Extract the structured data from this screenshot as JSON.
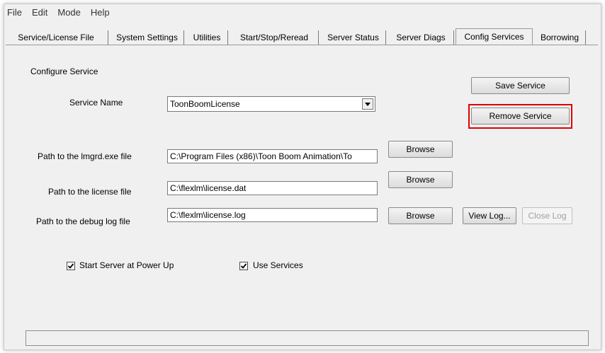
{
  "menu": [
    "File",
    "Edit",
    "Mode",
    "Help"
  ],
  "tabs": [
    {
      "label": "Service/License File",
      "active": false
    },
    {
      "label": "System Settings",
      "active": false
    },
    {
      "label": "Utilities",
      "active": false
    },
    {
      "label": "Start/Stop/Reread",
      "active": false
    },
    {
      "label": "Server Status",
      "active": false
    },
    {
      "label": "Server Diags",
      "active": false
    },
    {
      "label": "Config Services",
      "active": true
    },
    {
      "label": "Borrowing",
      "active": false
    }
  ],
  "config": {
    "section_title": "Configure Service",
    "service_name_label": "Service Name",
    "service_name_value": "ToonBoomLicense",
    "lmgrd_label": "Path to the lmgrd.exe file",
    "lmgrd_value": "C:\\Program Files (x86)\\Toon Boom Animation\\To",
    "license_label": "Path to the license file",
    "license_value": "C:\\flexlm\\license.dat",
    "debug_label": "Path to the debug log file",
    "debug_value": "C:\\flexlm\\license.log",
    "browse_label": "Browse",
    "view_log_label": "View Log...",
    "close_log_label": "Close Log",
    "save_service_label": "Save Service",
    "remove_service_label": "Remove Service",
    "start_at_power_up_label": "Start Server at Power Up",
    "start_at_power_up_checked": true,
    "use_services_label": "Use Services",
    "use_services_checked": true
  },
  "colors": {
    "highlight": "#e00000",
    "window_bg": "#f0f0f0"
  }
}
